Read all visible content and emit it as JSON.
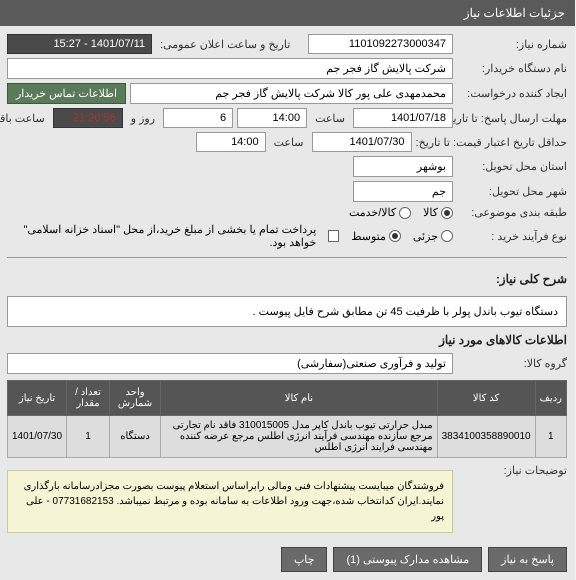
{
  "header": {
    "title": "جزئیات اطلاعات نیاز"
  },
  "form": {
    "need_no_label": "شماره نیاز:",
    "need_no": "1101092273000347",
    "public_date_label": "تاریخ و ساعت اعلان عمومی:",
    "public_date": "1401/07/11 - 15:27",
    "buyer_label": "نام دستگاه خریدار:",
    "buyer": "شرکت پالایش گاز فجر جم",
    "requester_label": "ایجاد کننده درخواست:",
    "requester": "محمدمهدی علی پور کالا شرکت پالایش گاز فجر جم",
    "contact_btn": "اطلاعات تماس خریدار",
    "deadline_label": "مهلت ارسال پاسخ: تا تاریخ:",
    "deadline_date": "1401/07/18",
    "time_label": "ساعت",
    "deadline_time": "14:00",
    "days_left": "6",
    "and_label": "روز و",
    "countdown": "21:20:56",
    "remain_label": "ساعت باقی مانده",
    "validity_label": "حداقل تاریخ اعتبار قیمت: تا تاریخ:",
    "validity_date": "1401/07/30",
    "validity_time": "14:00",
    "province_label": "استان محل تحویل:",
    "province": "بوشهر",
    "city_label": "شهر محل تحویل:",
    "city": "جم",
    "subject_cat_label": "طبقه بندی موضوعی:",
    "cat_kala": "کالا",
    "cat_khadamat": "کالا/خدمت",
    "process_label": "نوع فرآیند خرید :",
    "proc_low": "جزئی",
    "proc_mid": "متوسط",
    "proc_note": "پرداخت تمام یا بخشی از مبلغ خرید،از محل \"اسناد خزانه اسلامی\" خواهد بود."
  },
  "desc": {
    "title": "شرح کلی نیاز:",
    "text": "دستگاه تیوب باندل پولر  با ظرفیت 45 تن مطابق شرح فایل پیوست ."
  },
  "goods": {
    "title": "اطلاعات کالاهای مورد نیاز",
    "group_label": "گروه کالا:",
    "group": "تولید و فرآوری صنعتی(سفارشی)",
    "cols": {
      "row": "ردیف",
      "code": "کد کالا",
      "name": "نام کالا",
      "unit": "واحد شمارش",
      "qty": "تعداد / مقدار",
      "date": "تاریخ نیاز"
    },
    "rows": [
      {
        "row": "1",
        "code": "3834100358890010",
        "name": "مبدل حرارتی تیوب باندل کاپر مدل 310015005 فاقد نام تجارتی مرجع سازنده مهندسی فرآیند انرژی اطلس مرجع عرضه کننده مهندسی فرایند انرژی اطلس",
        "unit": "دستگاه",
        "qty": "1",
        "date": "1401/07/30"
      }
    ]
  },
  "note": {
    "label": "توضیحات نیاز:",
    "text": "فروشندگان میبایست پیشنهادات فنی ومالی رابراساس استعلام پیوست بصورت مجزادرسامانه بارگذاری نمایند.ایران کدانتخاب شده،جهت ورود اطلاعات به سامانه بوده و مرتبط نمیباشد. 07731682153 - علی پور"
  },
  "buttons": {
    "back": "پاسخ به نیاز",
    "attach": "مشاهده مدارک پیوستی (1)",
    "print": "چاپ"
  }
}
